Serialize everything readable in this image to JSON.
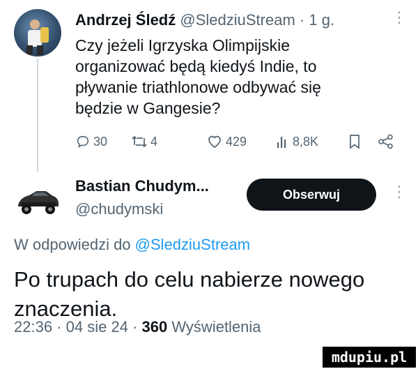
{
  "tweet1": {
    "author_name": "Andrzej Śledź",
    "handle": "@SledziuStream",
    "separator": "·",
    "age": "1 g.",
    "more_menu": "⋮",
    "text_lines": [
      "Czy jeżeli Igrzyska Olimpijskie",
      "organizować będą kiedyś Indie, to",
      "pływanie triathlonowe odbywać się",
      "będzie w Gangesie?"
    ],
    "actions": {
      "replies": "30",
      "retweets": "4",
      "likes": "429",
      "views": "8,8K"
    }
  },
  "tweet2": {
    "author_name": "Bastian Chudym...",
    "handle": "@chudymski",
    "follow_label": "Obserwuj",
    "more_menu": "⋮",
    "reply_prefix": "W odpowiedzi do",
    "reply_handle": "@SledziuStream",
    "text_lines": [
      "Po trupach do celu nabierze nowego",
      "znaczenia."
    ],
    "time": "22:36",
    "date": "04 sie 24",
    "separator": "·",
    "views_count": "360",
    "views_label": "Wyświetlenia"
  },
  "watermark": "mdupiu.pl",
  "colors": {
    "text": "#0f1419",
    "muted": "#536471",
    "link": "#1d9bf0",
    "button_bg": "#0f1419",
    "thread_line": "#cfd9de"
  }
}
